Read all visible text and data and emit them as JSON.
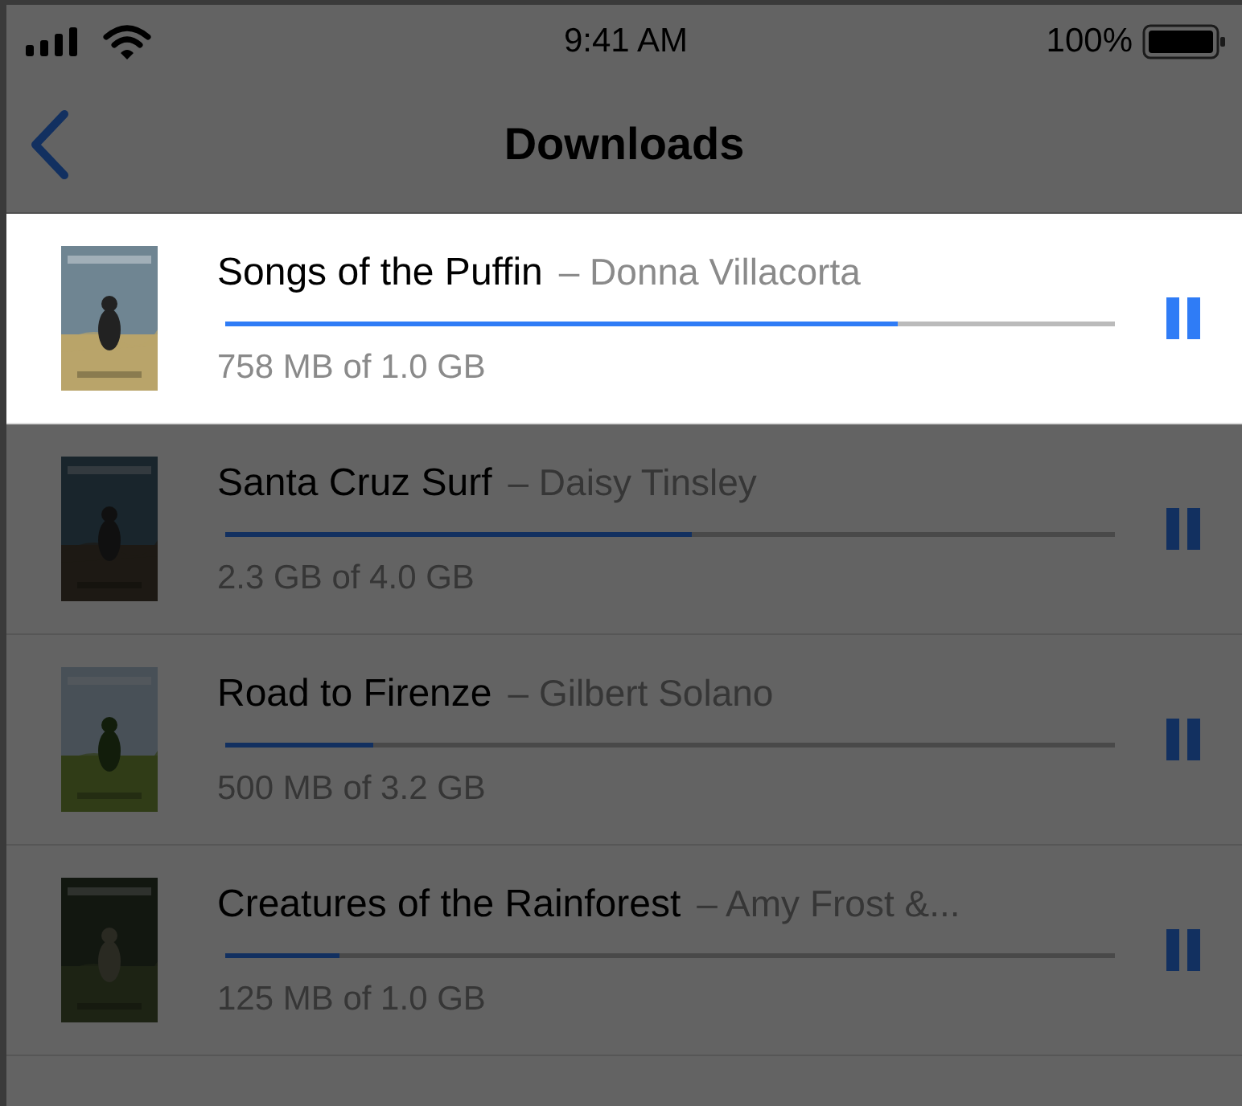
{
  "status_bar": {
    "time": "9:41 AM",
    "battery": "100%"
  },
  "nav": {
    "title": "Downloads"
  },
  "downloads": [
    {
      "title": "Songs of the Puffin",
      "artist": "– Donna Villacorta",
      "progress_text": "758 MB of 1.0 GB",
      "level": 0.756,
      "highlighted": true
    },
    {
      "title": "Santa Cruz Surf",
      "artist": "– Daisy Tinsley",
      "progress_text": "2.3 GB of 4.0 GB",
      "level": 0.524,
      "highlighted": false
    },
    {
      "title": "Road to Firenze",
      "artist": "– Gilbert Solano",
      "progress_text": "500 MB of 3.2 GB",
      "level": 0.166,
      "highlighted": false
    },
    {
      "title": "Creatures of the Rainforest",
      "artist": "– Amy Frost &...",
      "progress_text": "125 MB of 1.0 GB",
      "level": 0.128,
      "highlighted": false
    }
  ]
}
